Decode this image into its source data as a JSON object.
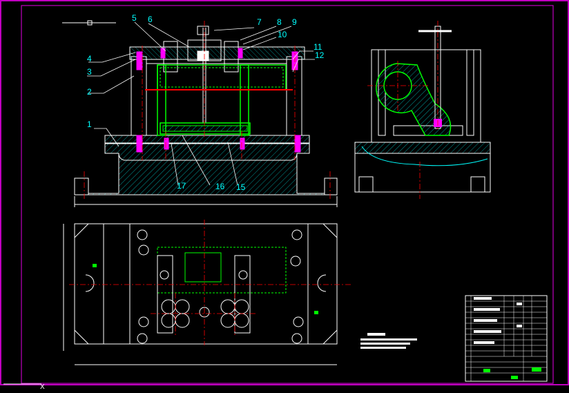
{
  "drawing": {
    "background": "#000000",
    "colors": {
      "frame": "#c000c0",
      "outline": "#ffffff",
      "part_labels": "#00ffff",
      "leader_lines": "#ffffff",
      "centerlines": "#ff0000",
      "workpiece": "#00ff00",
      "fasteners": "#ff00ff",
      "hatch": "#00ffff",
      "dimensions": "#ffffff"
    },
    "part_labels": [
      "1",
      "2",
      "3",
      "4",
      "5",
      "6",
      "7",
      "8",
      "9",
      "10",
      "11",
      "12",
      "15",
      "16",
      "17"
    ],
    "title_block": {
      "present": true
    }
  }
}
